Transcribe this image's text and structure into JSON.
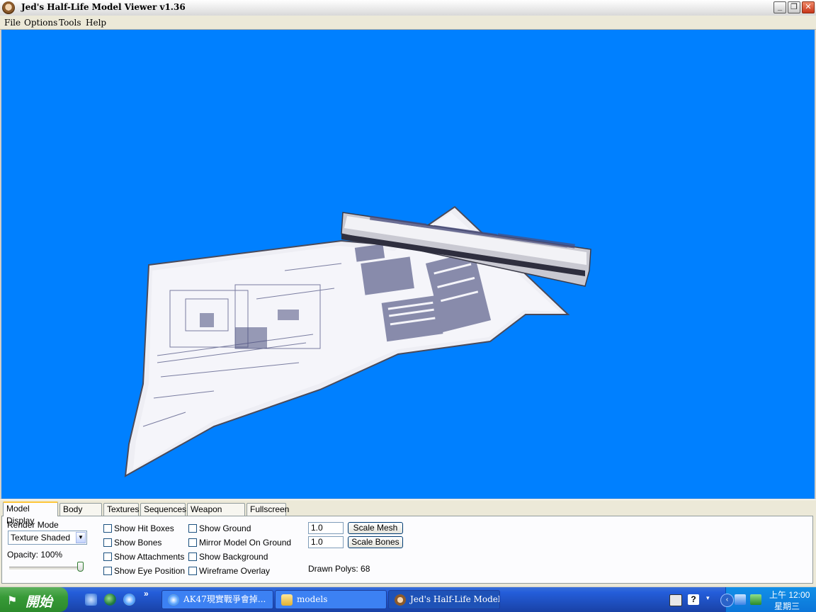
{
  "window": {
    "title": "Jed's Half-Life Model Viewer v1.36"
  },
  "menu": [
    "File",
    "Options",
    "Tools",
    "Help"
  ],
  "viewport": {
    "background_color": "#0080ff"
  },
  "tabs": [
    "Model Display",
    "Body Parts",
    "Textures",
    "Sequences",
    "Weapon Origin",
    "Fullscreen"
  ],
  "model_display": {
    "render_mode_label": "Render Mode",
    "render_mode_value": "Texture Shaded",
    "opacity_label": "Opacity: 100%",
    "opacity_value": 1.0,
    "checkboxes_col1": [
      "Show Hit Boxes",
      "Show Bones",
      "Show Attachments",
      "Show Eye Position"
    ],
    "checkboxes_col2": [
      "Show Ground",
      "Mirror Model On Ground",
      "Show Background",
      "Wireframe Overlay"
    ],
    "scale_mesh_value": "1.0",
    "scale_mesh_button": "Scale Mesh",
    "scale_bones_value": "1.0",
    "scale_bones_button": "Scale Bones",
    "drawn_polys": "Drawn Polys: 68"
  },
  "taskbar": {
    "start_label": "開始",
    "tasks": [
      "AK47現實戰爭會掉...",
      "models",
      "Jed's Half-Life Model ..."
    ],
    "clock_time": "上午 12:00",
    "clock_day": "星期三"
  }
}
